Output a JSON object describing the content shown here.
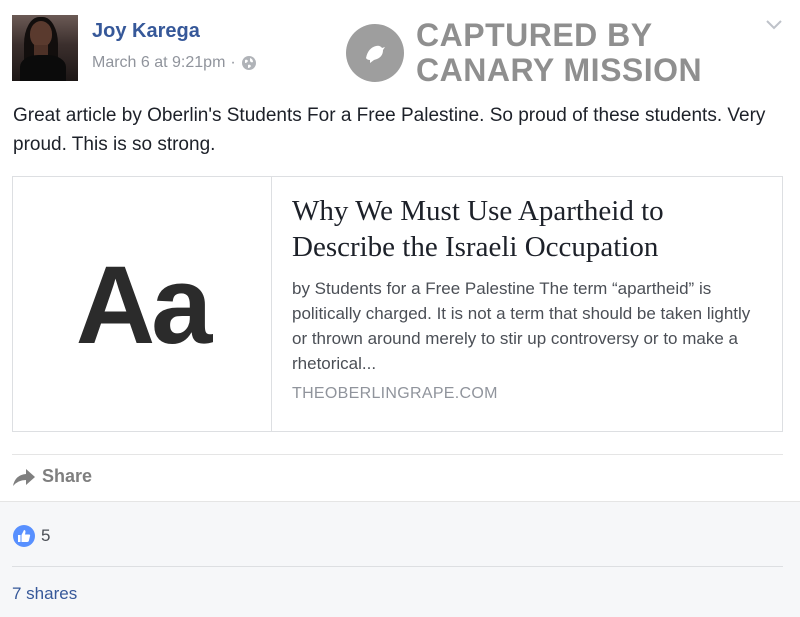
{
  "post": {
    "author": "Joy Karega",
    "timestamp": "March 6 at 9:21pm",
    "separator": "·",
    "privacy_icon": "globe-icon",
    "text": "Great article by Oberlin's Students For a Free Palestine. So proud of these students. Very proud. This is so strong."
  },
  "watermark": {
    "line1": "CAPTURED BY",
    "line2": "CANARY MISSION",
    "icon": "canary-bird-icon"
  },
  "link_preview": {
    "thumbnail_glyph": "Aa",
    "title": "Why We Must Use Apartheid to Describe the Israeli Occupation",
    "description": "by Students for a Free Palestine The term “apartheid” is politically charged. It is not a term that should be taken lightly or thrown around merely to stir up controversy or to make a rhetorical...",
    "domain": "THEOBERLINGRAPE.COM"
  },
  "actions": {
    "share_label": "Share",
    "share_icon": "share-arrow-icon"
  },
  "stats": {
    "likes": "5",
    "like_icon": "like-thumb-icon",
    "shares": "7 shares"
  },
  "colors": {
    "link_blue": "#365899",
    "like_blue": "#5890ff",
    "muted_grey": "#90949c",
    "footer_bg": "#f6f7f9"
  }
}
